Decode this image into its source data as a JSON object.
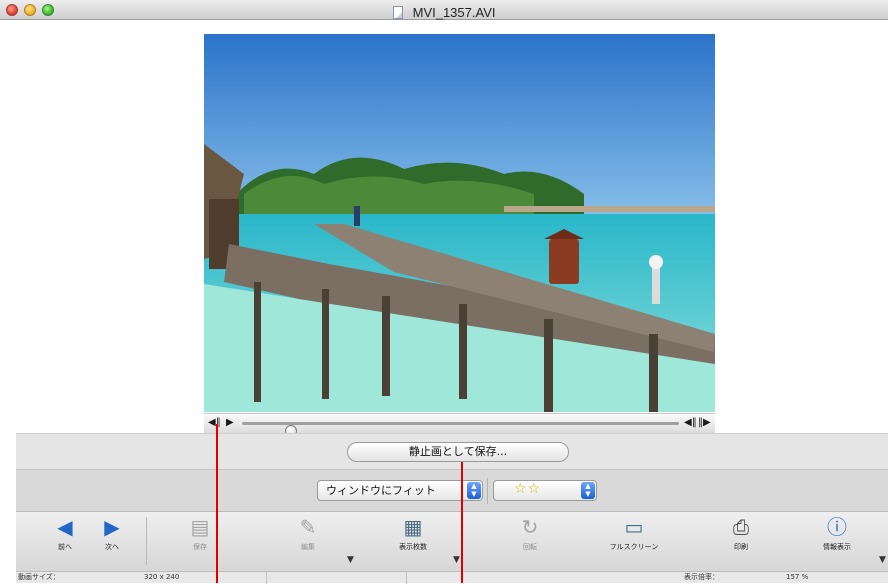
{
  "window": {
    "title": "MVI_1357.AVI"
  },
  "player": {
    "transport": {
      "step_back": "◀‖",
      "play": "▶",
      "skip_back": "◀‖",
      "skip_forward": "‖▶"
    },
    "progress": 0.1
  },
  "actions": {
    "save_still_label": "静止画として保存..."
  },
  "view": {
    "fit_label": "ウィンドウにフィット",
    "rating_stars": "☆☆",
    "rating_value": 2
  },
  "toolbar": {
    "prev_label": "前へ",
    "next_label": "次へ",
    "save_label": "保存",
    "edit_label": "編集",
    "count_label": "表示枚数",
    "rotate_label": "回転",
    "fullscreen_label": "フルスクリーン",
    "print_label": "印刷",
    "info_label": "情報表示"
  },
  "status": {
    "size_label": "動画サイズ：",
    "size_value": "320 x 240",
    "zoom_label": "表示倍率：",
    "zoom_value": "157 %"
  },
  "colors": {
    "callout": "#e00000",
    "stepper": "#1b5fd0",
    "star": "#d8b600"
  }
}
